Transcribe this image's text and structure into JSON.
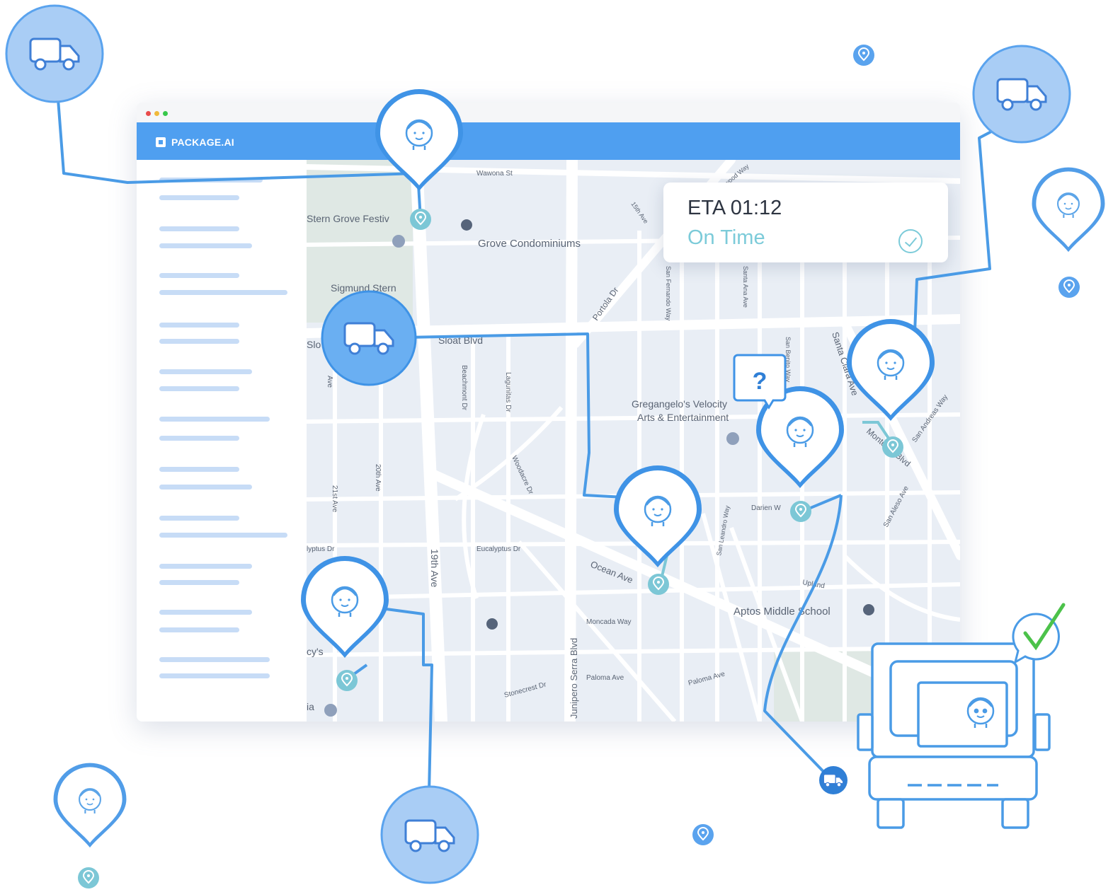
{
  "window": {
    "brand": "PACKAGE.AI",
    "traffic_lights": [
      "#e94b4b",
      "#f0b93a",
      "#37c84b"
    ]
  },
  "eta_card": {
    "title": "ETA 01:12",
    "status": "On Time",
    "status_color": "#7ccbd9"
  },
  "map": {
    "labels": {
      "wawona": "Wawona St",
      "stern_grove": "Stern Grove Festiv",
      "grove_condos": "Grove Condominiums",
      "sigmund": "Sigmund Stern",
      "sloat": "Sloat Blvd",
      "slo": "Slo",
      "gregangelo1": "Gregangelo's Velocity",
      "gregangelo2": "Arts & Entertainment",
      "ocean": "Ocean Ave",
      "nineteenth": "19th Ave",
      "eucalyptus": "Eucalyptus Dr",
      "eucalyptus2": "lyptus Dr",
      "moncada": "Moncada Way",
      "paloma": "Paloma Ave",
      "paloma2": "Paloma Ave",
      "stonecrest": "Stonecrest Dr",
      "aptos": "Aptos Middle School",
      "darien": "Darien W",
      "upland": "Upland",
      "santa_clara": "Santa Clara Ave",
      "junipero": "Junipero Serra Blvd",
      "portola": "Portola Dr",
      "monterey": "Monterey Blvd",
      "san_aleso": "San Aleso Ave",
      "san_andreas": "San Andreas Way",
      "beachmont": "Beachmont Dr",
      "lagunitas": "Lagunitas Dr",
      "woodacre": "Woodacre Dr",
      "twentieth": "20th Ave",
      "twentyfirst": "21st Ave",
      "ave_short": "Ave",
      "san_fernando": "San Fernando Way",
      "santa_ana": "Santa Ana Ave",
      "san_leandro": "San Leandro Way",
      "san_benito": "San Benito Way",
      "fifteenth": "15th Ave",
      "wildwood": "Wildwood Way",
      "cys": "cy's",
      "ia": "ia",
      "q_mark": "?"
    }
  },
  "colors": {
    "brand_blue": "#4f9ff0",
    "route_blue": "#4a9be6",
    "light_blue": "#a9cdf5",
    "teal": "#7ccbd9",
    "check_green": "#4cc24a"
  }
}
